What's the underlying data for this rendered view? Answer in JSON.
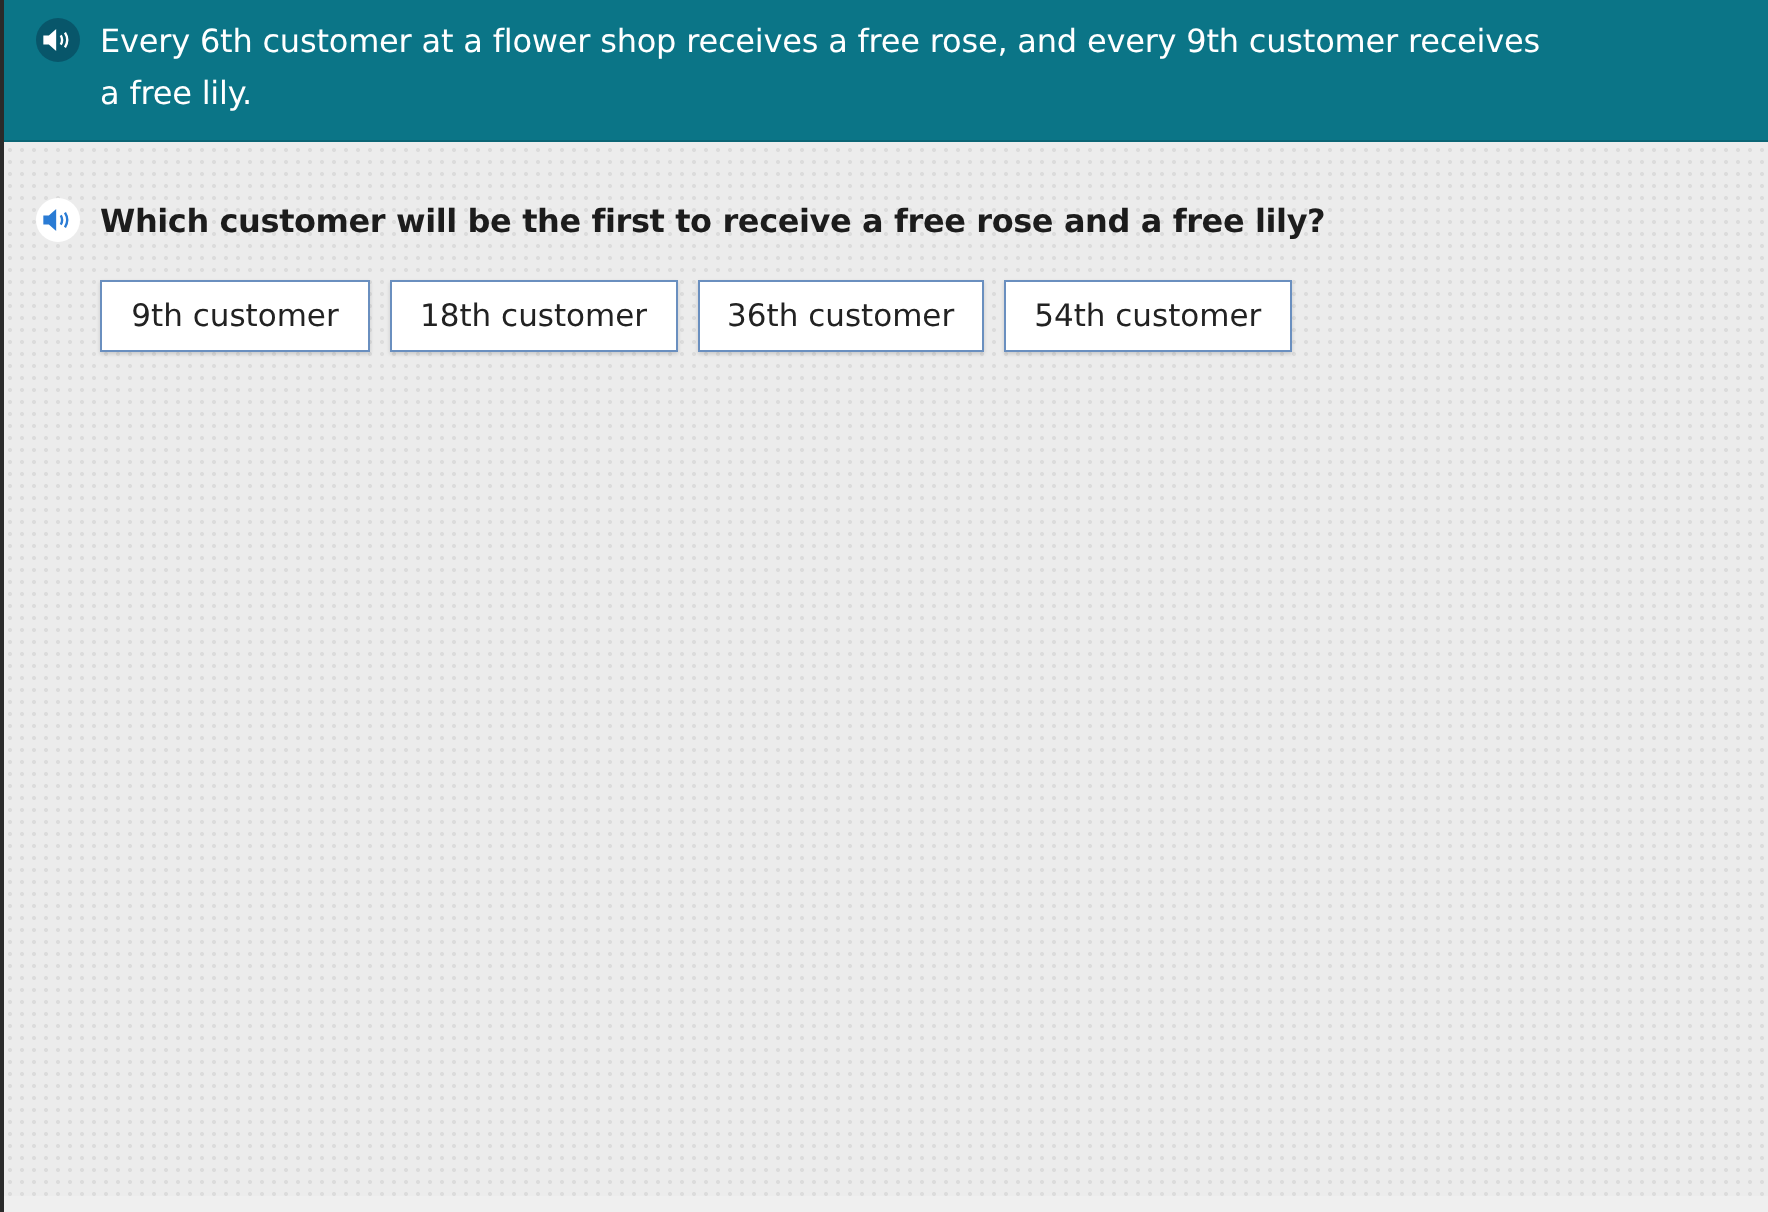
{
  "prompt": {
    "text": "Every 6th customer at a flower shop receives a free rose, and every 9th customer receives a free lily."
  },
  "question": {
    "text": "Which customer will be the first to receive a free rose and a free lily?"
  },
  "choices": [
    {
      "label": "9th customer",
      "selected": false
    },
    {
      "label": "18th customer",
      "selected": false
    },
    {
      "label": "36th customer",
      "selected": false
    },
    {
      "label": "54th customer",
      "selected": false
    }
  ]
}
